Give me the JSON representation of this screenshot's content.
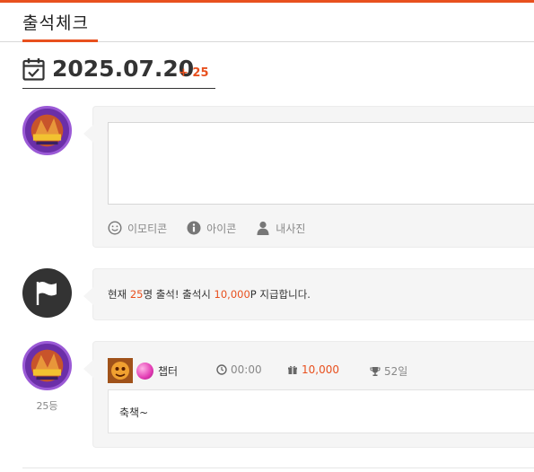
{
  "header": {
    "title": "출석체크"
  },
  "date_row": {
    "date": "2025.07.20",
    "count": "+ 25"
  },
  "compose": {
    "tools": [
      {
        "icon": "smile-icon",
        "label": "이모티콘"
      },
      {
        "icon": "info-icon",
        "label": "아이콘"
      },
      {
        "icon": "person-icon",
        "label": "내사진"
      }
    ]
  },
  "notice": {
    "prefix": "현재 ",
    "attendees": "25",
    "middle": "명 출석! 출석시 ",
    "points": "10,000",
    "suffix": "P 지급합니다."
  },
  "entry": {
    "username": "챕터",
    "time": "00:00",
    "points": "10,000",
    "streak": "52일",
    "message": "축책~",
    "rank": "25등"
  },
  "colors": {
    "accent": "#e8501e",
    "card_bg": "#f5f5f5",
    "avatar_purple": "#7a3fb8",
    "gem_pink": "#e23bb3"
  }
}
